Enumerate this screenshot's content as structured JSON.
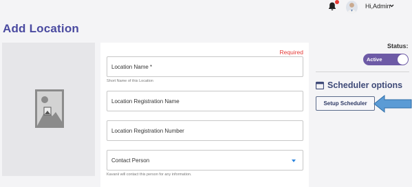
{
  "header": {
    "greeting": "Hi,Admin"
  },
  "page": {
    "title": "Add Location"
  },
  "form": {
    "required_label": "Required",
    "fields": [
      {
        "label": "Location Name *",
        "hint": "Short Name of this Location"
      },
      {
        "label": "Location Registration Name"
      },
      {
        "label": "Location Registration Number"
      },
      {
        "label": "Contact Person",
        "hint": "Kavanii will contact this person for any information."
      }
    ]
  },
  "status": {
    "label": "Status:",
    "value": "Active"
  },
  "scheduler": {
    "title": "Scheduler options",
    "button_label": "Setup Scheduler"
  },
  "colors": {
    "accent": "#4a4aa0",
    "toggle": "#6d5aa6",
    "required": "#e53935",
    "pointer_arrow": "#5b9bd5"
  }
}
